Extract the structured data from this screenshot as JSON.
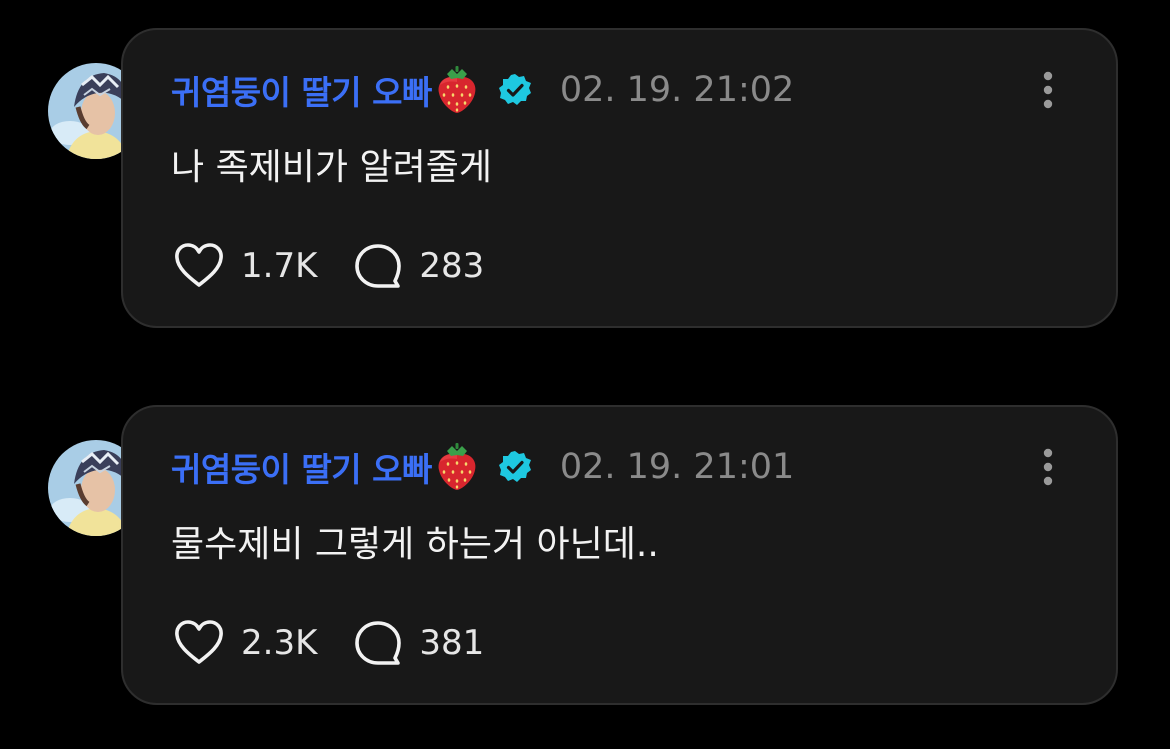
{
  "posts": [
    {
      "username": "귀염둥이 딸기 오빠",
      "username_emoji": "strawberry",
      "verified": true,
      "timestamp": "02. 19. 21:02",
      "text": "나 족제비가 알려줄게",
      "likes": "1.7K",
      "replies": "283"
    },
    {
      "username": "귀염둥이 딸기 오빠",
      "username_emoji": "strawberry",
      "verified": true,
      "timestamp": "02. 19. 21:01",
      "text": "물수제비 그렇게 하는거 아닌데..",
      "likes": "2.3K",
      "replies": "381"
    }
  ],
  "icons": {
    "like": "heart-icon",
    "reply": "speech-bubble-icon",
    "more": "vertical-dots-icon",
    "verified": "verified-badge-icon"
  },
  "colors": {
    "background": "#000000",
    "card": "#181818",
    "card_border": "#2e2e2e",
    "username": "#3b6ff6",
    "verified_badge": "#1ec8e0",
    "timestamp": "#8a8a8a",
    "text": "#f2f2f2"
  }
}
